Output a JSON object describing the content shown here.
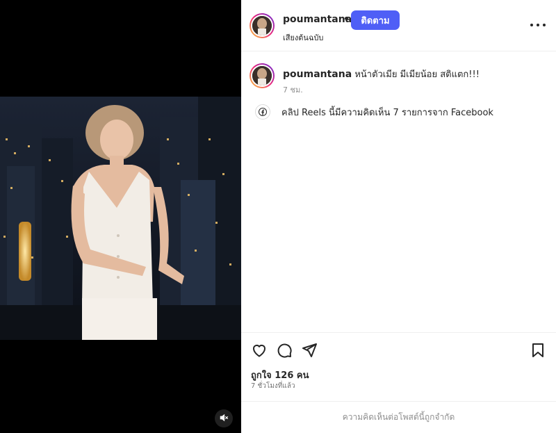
{
  "post": {
    "username": "poumantana",
    "separator": "•",
    "follow_label": "ติดตาม",
    "audio_label": "เสียงต้นฉบับ",
    "caption_username": "poumantana",
    "caption_text": "หน้าตัวเมีย มีเมียน้อย สติแตก!!!",
    "caption_time": "7 ชม.",
    "facebook_note": "คลิป Reels นี้มีความคิดเห็น 7 รายการจาก Facebook",
    "likes": "ถูกใจ 126 คน",
    "posted_ago": "7 ชั่วโมงที่แล้ว",
    "comments_disabled": "ความคิดเห็นต่อโพสต์นี้ถูกจำกัด"
  },
  "icons": {
    "more": "more-options-icon",
    "like": "heart-icon",
    "comment": "comment-icon",
    "share": "share-icon",
    "save": "bookmark-icon",
    "mute": "speaker-muted-icon",
    "facebook": "facebook-icon"
  },
  "colors": {
    "follow_button": "#4f5ff6",
    "text": "#262626",
    "muted_text": "#8e8e8e"
  }
}
